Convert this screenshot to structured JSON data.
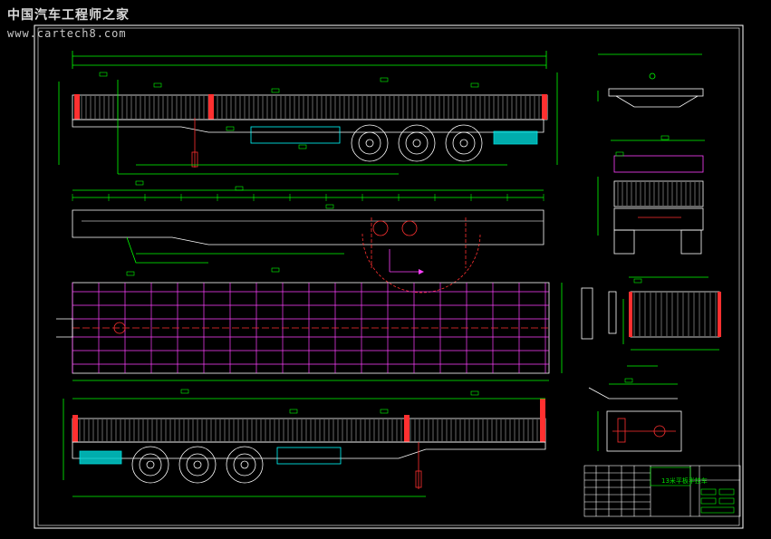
{
  "watermark": {
    "site_name": "中国汽车工程师之家",
    "site_url": "www.cartech8.com"
  },
  "title_block": {
    "title": "13米平板半挂车"
  },
  "colors": {
    "background": "#000000",
    "frame": "#ffffff",
    "dimension": "#00ff00",
    "grid": "#ff40ff",
    "center_mark": "#ff0000",
    "fender": "#00ffff",
    "watermark_text": "#d9d9d9"
  }
}
